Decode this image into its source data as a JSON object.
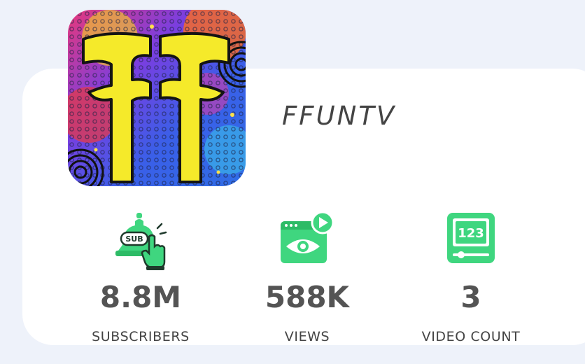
{
  "channel": {
    "name": "FFUNTV",
    "avatar_icon": "ffuntv-logo"
  },
  "stats": [
    {
      "icon": "subscribe-bell-icon",
      "value": "8.8M",
      "label": "SUBSCRIBERS"
    },
    {
      "icon": "video-views-eye-icon",
      "value": "588K",
      "label": "VIEWS"
    },
    {
      "icon": "video-count-123-icon",
      "value": "3",
      "label": "VIDEO COUNT"
    }
  ],
  "colors": {
    "accent": "#3fd67f",
    "card": "#ffffff",
    "background": "#eef2fa",
    "text": "#545454"
  }
}
